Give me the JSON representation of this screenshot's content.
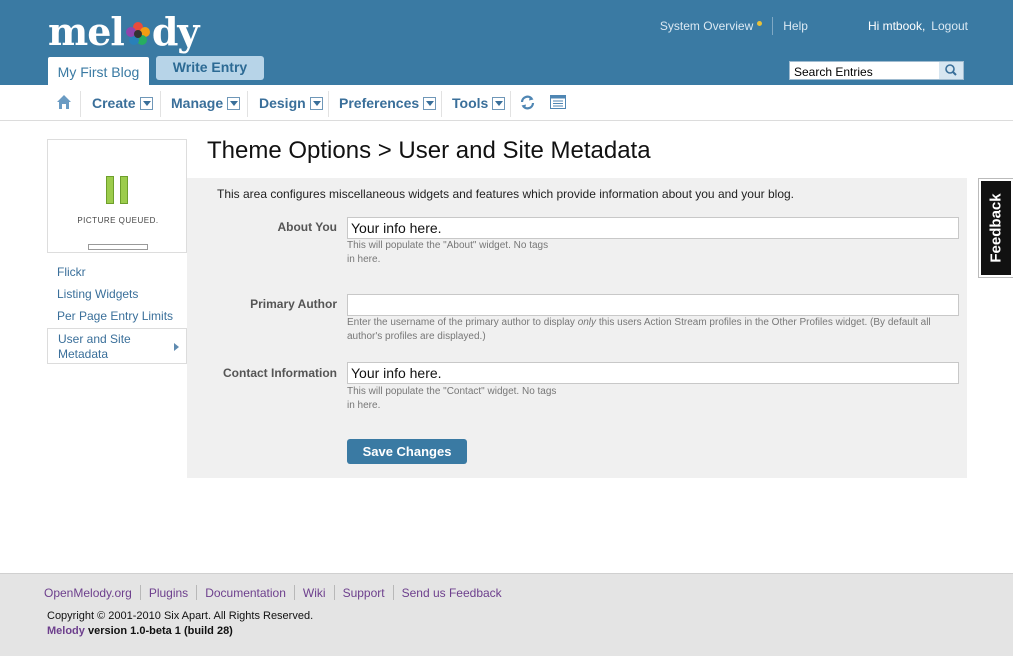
{
  "header": {
    "logo": "melody",
    "system_overview": "System Overview",
    "help": "Help",
    "greeting": "Hi mtbook,",
    "logout": "Logout",
    "blog_tab": "My First Blog",
    "write_entry": "Write Entry",
    "search_placeholder": "Search Entries"
  },
  "nav": {
    "items": [
      "Create",
      "Manage",
      "Design",
      "Preferences",
      "Tools"
    ]
  },
  "sidebar": {
    "thumbnail_caption": "PICTURE QUEUED.",
    "items": [
      "Flickr",
      "Listing Widgets",
      "Per Page Entry Limits",
      "User and Site Metadata"
    ]
  },
  "main": {
    "title": "Theme Options > User and Site Metadata",
    "intro": "This area configures miscellaneous widgets and features which provide information about you and your blog.",
    "fields": [
      {
        "label": "About You",
        "value": "Your info here.",
        "hint": "This will populate the \"About\" widget. No tags in here."
      },
      {
        "label": "Primary Author",
        "value": "",
        "hint_pre": "Enter the username of the primary author to display ",
        "hint_em": "only",
        "hint_post": " this users Action Stream profiles in the Other Profiles widget. (By default all author's profiles are displayed.)"
      },
      {
        "label": "Contact Information",
        "value": "Your info here.",
        "hint": "This will populate the \"Contact\" widget. No tags in here."
      }
    ],
    "save_button": "Save Changes"
  },
  "feedback_tab": "Feedback",
  "footer": {
    "links": [
      "OpenMelody.org",
      "Plugins",
      "Documentation",
      "Wiki",
      "Support",
      "Send us Feedback"
    ],
    "copyright": "Copyright © 2001-2010 Six Apart. All Rights Reserved.",
    "brand": "Melody",
    "version": "version 1.0-beta 1 (build 28)"
  },
  "colors": {
    "header": "#3a7aa3",
    "link": "#3a6f9a",
    "footer_link": "#6d3f8d"
  }
}
